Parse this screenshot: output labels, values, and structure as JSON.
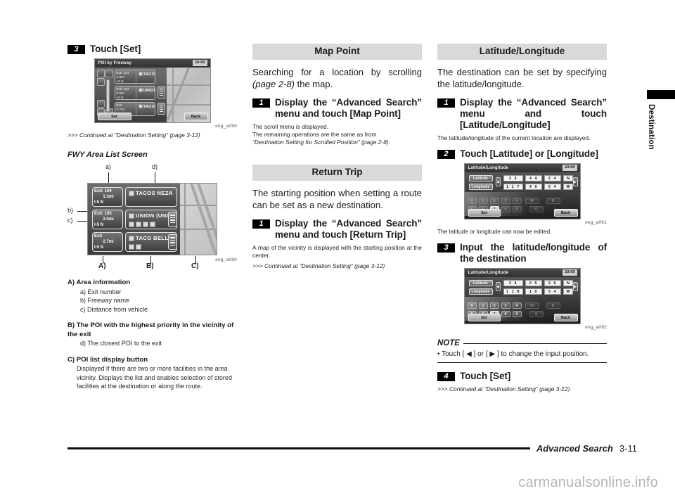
{
  "page": {
    "footer_title": "Advanced Search",
    "footer_page": "3-11",
    "side_tab_label": "Destination",
    "watermark": "carmanualsonline.info"
  },
  "left_column": {
    "step3": {
      "num": "3",
      "title": "Touch [Set]"
    },
    "figure_poi": {
      "caption": "eng_a090",
      "screen_title": "POI by Freeway",
      "clock": "10:00",
      "set_label": "Set",
      "back_label": "Back",
      "rows": [
        {
          "exit": "Exit: 104",
          "dist": "1.3mi",
          "road": "I-5 N",
          "poi": "TACOS NEZA"
        },
        {
          "exit": "Exit: 104",
          "dist": "2.0mi",
          "road": "I-5 N",
          "poi": "UNION (UNO"
        },
        {
          "exit": "Exit",
          "dist": "2.7mi",
          "road": "I-5 N",
          "poi": "TACO BELL"
        }
      ]
    },
    "continued_1": ">>> Continued at \"Destination Setting\" (page 3-12)",
    "fwy_heading": "FWY Area List Screen",
    "figure_fwy": {
      "caption": "eng_a090",
      "callouts_top": [
        "a)",
        "d)"
      ],
      "callouts_left": [
        "b)",
        "c)"
      ],
      "callouts_bottom": [
        "A)",
        "B)",
        "C)"
      ],
      "rows": [
        {
          "exit": "Exit: 104",
          "dist": "1.3mi",
          "road": "I-5 N",
          "poi": "TACOS NEZA"
        },
        {
          "exit": "Exit: 105",
          "dist": "2.0mi",
          "road": "I-5 N",
          "poi": "UNION (UNO"
        },
        {
          "exit": "Exit",
          "dist": "2.7mi",
          "road": "I-5 N",
          "poi": "TACO BELL"
        }
      ]
    },
    "definitions": [
      {
        "marker": "A)",
        "title": "Area information",
        "subs": [
          "a) Exit number",
          "b) Freeway name",
          "c) Distance from vehicle"
        ],
        "para": ""
      },
      {
        "marker": "B)",
        "title": "The POI with the highest priority in the vicinity of the exit",
        "subs": [
          "d) The closest POI to the exit"
        ],
        "para": ""
      },
      {
        "marker": "C)",
        "title": "POI list display button",
        "subs": [],
        "para": "Displayed if there are two or more facilities in the area vicinity. Displays the list and enables selection of stored facilities at the destination or along the route."
      }
    ]
  },
  "middle_column": {
    "map_point": {
      "bar": "Map Point",
      "intro_a": "Searching for a location by scrolling ",
      "intro_ital": "(page 2-8)",
      "intro_b": " the map.",
      "step_num": "1",
      "step_title": "Display the “Advanced Search” menu and touch [Map Point]",
      "note_1": "The scroll menu is displayed.",
      "note_2": "The remaining operations are the same as from",
      "note_3": "“Destination Setting for Scrolled Position” (page 2-8)."
    },
    "return_trip": {
      "bar": "Return Trip",
      "intro": "The starting position when setting a route can be set as a new destination.",
      "step_num": "1",
      "step_title": "Display the “Advanced Search” menu and touch [Return Trip]",
      "note_1": "A map of the vicinity is displayed with the starting position at the center.",
      "continued": ">>> Continued at “Destination Setting” (page 3-12)"
    }
  },
  "right_column": {
    "lat_long": {
      "bar": "Latitude/Longitude",
      "intro": "The destination can be set by specifying the latitude/longitude.",
      "step1_num": "1",
      "step1_title": "Display the “Advanced Search” menu and touch [Latitude/Longitude]",
      "step1_note": "The latitude/longitude of the current location are displayed.",
      "step2_num": "2",
      "step2_title": "Touch [Latitude] or [Longitude]",
      "figure1": {
        "caption": "eng_a091",
        "screen_title": "Latitude/Longitude",
        "clock": "10:00",
        "lat_label": "Latitude",
        "lon_label": "Longitude",
        "lat_values": [
          "3 3",
          "4 4",
          "2 4",
          "N"
        ],
        "lon_values": [
          "1 1 7",
          "4 9",
          "5 4",
          "W"
        ],
        "set_label": "Set",
        "back_label": "Back",
        "keys_row1": [
          "0",
          "1",
          "2",
          "3",
          "4",
          "W",
          "E"
        ],
        "keys_row2": [
          "5",
          "6",
          "7",
          "8",
          "9",
          "S"
        ]
      },
      "after_fig1": "The latitude or longitude can now be edited.",
      "step3_num": "3",
      "step3_title": "Input the latitude/longitude of the destination",
      "figure2": {
        "caption": "eng_a092",
        "screen_title": "Latitude/Longitude",
        "clock": "10:00",
        "lat_label": "Latitude",
        "lon_label": "Longitude",
        "lat_values": [
          "3 4",
          "0 5",
          "2 6",
          "N"
        ],
        "lon_values": [
          "1 1 8",
          "1 0",
          "5 4",
          "W"
        ],
        "set_label": "Set",
        "back_label": "Back",
        "keys_row1": [
          "0",
          "1",
          "2",
          "3",
          "4",
          "W",
          "E"
        ],
        "keys_row2": [
          "5",
          "6",
          "7",
          "8",
          "9",
          "S"
        ]
      },
      "note_head": "NOTE",
      "note_body": "• Touch [ ◀ ] or [ ▶ ] to change the input position.",
      "step4_num": "4",
      "step4_title": "Touch [Set]",
      "continued": ">>> Continued at “Destination Setting” (page 3-12)"
    }
  }
}
